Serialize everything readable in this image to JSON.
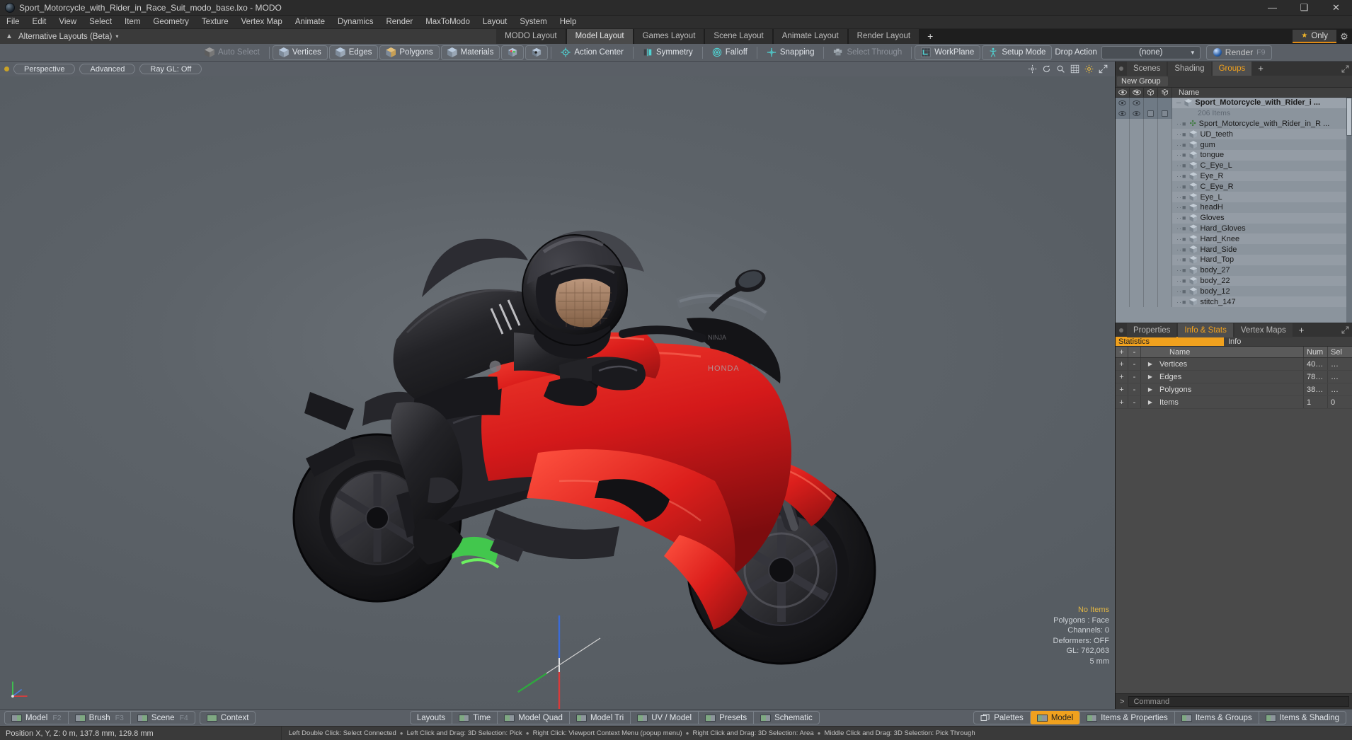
{
  "window": {
    "title": "Sport_Motorcycle_with_Rider_in_Race_Suit_modo_base.lxo - MODO",
    "minimize": "—",
    "maximize": "❑",
    "close": "✕"
  },
  "menubar": {
    "items": [
      "File",
      "Edit",
      "View",
      "Select",
      "Item",
      "Geometry",
      "Texture",
      "Vertex Map",
      "Animate",
      "Dynamics",
      "Render",
      "MaxToModo",
      "Layout",
      "System",
      "Help"
    ]
  },
  "layout_row": {
    "alternative_layouts": "Alternative Layouts (Beta)",
    "caret": "▾",
    "tabs": [
      {
        "label": "MODO Layout",
        "active": false
      },
      {
        "label": "Model Layout",
        "active": true
      },
      {
        "label": "Games Layout",
        "active": false
      },
      {
        "label": "Scene Layout",
        "active": false
      },
      {
        "label": "Animate Layout",
        "active": false
      },
      {
        "label": "Render Layout",
        "active": false
      }
    ],
    "add_tab": "+",
    "only_label": "Only",
    "star": "★",
    "gear": "⚙"
  },
  "toolbar": {
    "auto_select": "Auto Select",
    "vertices": "Vertices",
    "edges": "Edges",
    "polygons": "Polygons",
    "materials": "Materials",
    "action_center": "Action Center",
    "symmetry": "Symmetry",
    "falloff": "Falloff",
    "snapping": "Snapping",
    "select_through": "Select Through",
    "workplane": "WorkPlane",
    "setup_mode": "Setup Mode",
    "drop_action_label": "Drop Action",
    "drop_action_value": "(none)",
    "render": "Render",
    "render_key": "F9"
  },
  "viewport": {
    "view_mode": "Perspective",
    "shading": "Advanced",
    "raygl": "Ray GL: Off",
    "overlay": {
      "items": "No Items",
      "polygons": "Polygons : Face",
      "channels": "Channels: 0",
      "deformers": "Deformers: OFF",
      "gl": "GL: 762,063",
      "scale": "5 mm"
    }
  },
  "groups_panel": {
    "tabs": [
      {
        "label": "Scenes",
        "active": false
      },
      {
        "label": "Shading",
        "active": false
      },
      {
        "label": "Groups",
        "active": true
      }
    ],
    "add_tab": "+",
    "new_group": "New Group",
    "name_column": "Name",
    "root_item": "Sport_Motorcycle_with_Rider_i ...",
    "item_count": "206 Items",
    "items": [
      "Sport_Motorcycle_with_Rider_in_R ...",
      "UD_teeth",
      "gum",
      "tongue",
      "C_Eye_L",
      "Eye_R",
      "C_Eye_R",
      "Eye_L",
      "headH",
      "Gloves",
      "Hard_Gloves",
      "Hard_Knee",
      "Hard_Side",
      "Hard_Top",
      "body_27",
      "body_22",
      "body_12",
      "stitch_147"
    ]
  },
  "info_panel": {
    "tabs": [
      {
        "label": "Properties",
        "active": false
      },
      {
        "label": "Info & Stats",
        "active": true
      },
      {
        "label": "Vertex Maps",
        "active": false
      }
    ],
    "add_tab": "+",
    "statistics": "Statistics",
    "info": "Info",
    "columns": {
      "plus": "+",
      "minus": "-",
      "name": "Name",
      "num": "Num",
      "sel": "Sel"
    },
    "rows": [
      {
        "name": "Vertices",
        "num": "40…",
        "sel": "…"
      },
      {
        "name": "Edges",
        "num": "78…",
        "sel": "…"
      },
      {
        "name": "Polygons",
        "num": "38…",
        "sel": "…"
      },
      {
        "name": "Items",
        "num": "1",
        "sel": "0"
      }
    ]
  },
  "command_bar": {
    "arrow": ">",
    "placeholder": "Command"
  },
  "bottom_toolbar": {
    "left_modes": [
      {
        "label": "Model",
        "key": "F2"
      },
      {
        "label": "Brush",
        "key": "F3"
      },
      {
        "label": "Scene",
        "key": "F4"
      }
    ],
    "context": "Context",
    "center": [
      {
        "label": "Layouts",
        "swatch": false
      },
      {
        "label": "Time",
        "swatch": true
      },
      {
        "label": "Model Quad",
        "swatch": true
      },
      {
        "label": "Model Tri",
        "swatch": true
      },
      {
        "label": "UV / Model",
        "swatch": true
      },
      {
        "label": "Presets",
        "swatch": true
      },
      {
        "label": "Schematic",
        "swatch": true
      }
    ],
    "right": [
      {
        "label": "Palettes",
        "active": false
      },
      {
        "label": "Model",
        "active": true
      },
      {
        "label": "Items & Properties",
        "active": false
      },
      {
        "label": "Items & Groups",
        "active": false
      },
      {
        "label": "Items & Shading",
        "active": false
      }
    ]
  },
  "statusbar": {
    "position": "Position X, Y, Z:   0 m, 137.8 mm, 129.8 mm",
    "hints": [
      "Left Double Click: Select Connected",
      "Left Click and Drag: 3D Selection: Pick",
      "Right Click: Viewport Context Menu (popup menu)",
      "Right Click and Drag: 3D Selection: Area",
      "Middle Click and Drag: 3D Selection: Pick Through"
    ],
    "separator": "●"
  },
  "colors": {
    "accent_orange": "#f0a11e",
    "toolbar_blue_gray": "#5a5f66",
    "panel_dark": "#3a3a3a",
    "bike_red": "#d81f1f",
    "suit_black": "#1d1d1f"
  }
}
